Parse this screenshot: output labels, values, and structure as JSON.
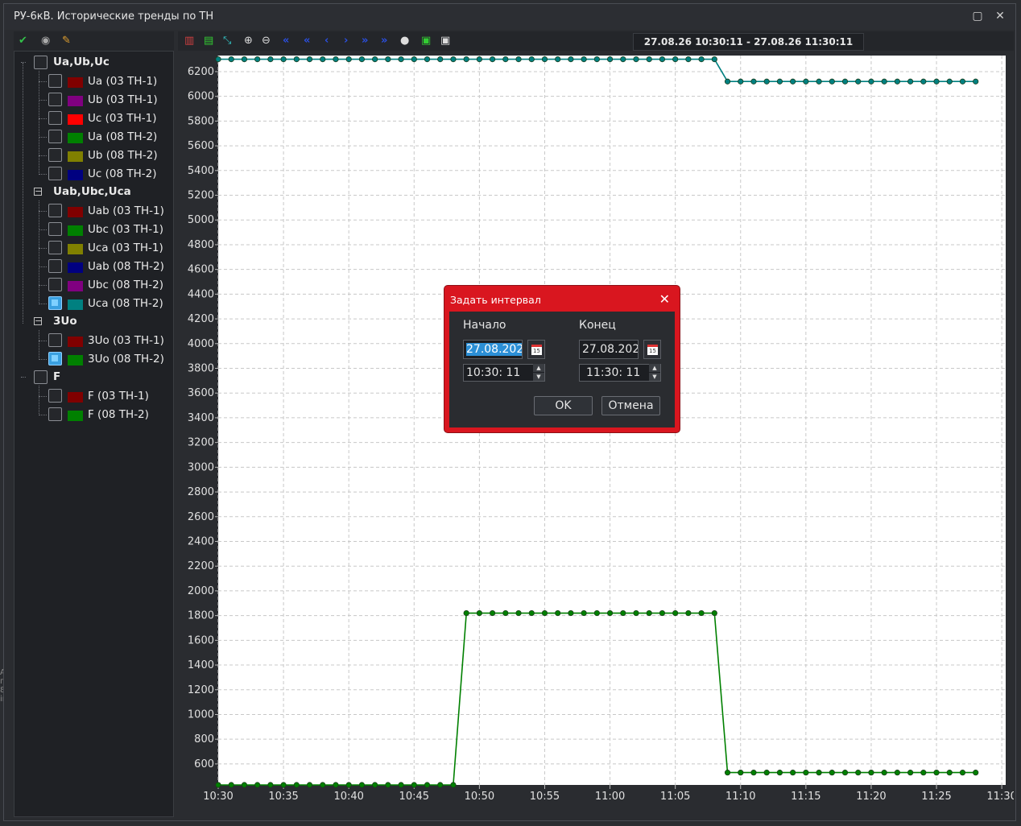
{
  "window": {
    "title": "РУ-6кВ. Исторические тренды по ТН"
  },
  "toolbar": {
    "range_label": "27.08.26 10:30:11 - 27.08.26 11:30:11"
  },
  "tree": {
    "groups": [
      {
        "label": "Ua,Ub,Uc",
        "items": [
          {
            "label": "Ua (03 ТН-1)",
            "color": "#800000",
            "checked": false
          },
          {
            "label": "Ub (03 ТН-1)",
            "color": "#800080",
            "checked": false
          },
          {
            "label": "Uc (03 ТН-1)",
            "color": "#ff0000",
            "checked": false
          },
          {
            "label": "Ua (08 ТН-2)",
            "color": "#008000",
            "checked": false
          },
          {
            "label": "Ub (08 ТН-2)",
            "color": "#808000",
            "checked": false
          },
          {
            "label": "Uc (08 ТН-2)",
            "color": "#000080",
            "checked": false
          }
        ]
      },
      {
        "label": "Uab,Ubc,Uca",
        "items": [
          {
            "label": "Uab (03 ТН-1)",
            "color": "#800000",
            "checked": false
          },
          {
            "label": "Ubc (03 ТН-1)",
            "color": "#008000",
            "checked": false
          },
          {
            "label": "Uca (03 ТН-1)",
            "color": "#808000",
            "checked": false
          },
          {
            "label": "Uab (08 ТН-2)",
            "color": "#000080",
            "checked": false
          },
          {
            "label": "Ubc (08 ТН-2)",
            "color": "#800080",
            "checked": false
          },
          {
            "label": "Uca (08 ТН-2)",
            "color": "#008080",
            "checked": true
          }
        ]
      },
      {
        "label": "3Uo",
        "items": [
          {
            "label": "3Uo (03 ТН-1)",
            "color": "#800000",
            "checked": false
          },
          {
            "label": "3Uo (08 ТН-2)",
            "color": "#008000",
            "checked": true
          }
        ]
      },
      {
        "label": "F",
        "items": [
          {
            "label": "F (03 ТН-1)",
            "color": "#800000",
            "checked": false
          },
          {
            "label": "F (08 ТН-2)",
            "color": "#008000",
            "checked": false
          }
        ]
      }
    ]
  },
  "dialog": {
    "title": "Задать интервал",
    "start_label": "Начало",
    "end_label": "Конец",
    "start_date": "27.08.202",
    "start_time": "10:30: 11",
    "end_date": "27.08.202",
    "end_time": "11:30: 11",
    "ok_label": "OK",
    "cancel_label": "Отмена",
    "cal_day": "15"
  },
  "left_edge_text": [
    "А",
    "г.",
    "8",
    "in"
  ],
  "chart_data": {
    "type": "line",
    "x_ticks": [
      "10:30",
      "10:35",
      "10:40",
      "10:45",
      "10:50",
      "10:55",
      "11:00",
      "11:05",
      "11:10",
      "11:15",
      "11:20",
      "11:25",
      "11:30"
    ],
    "y_ticks": [
      600,
      800,
      1000,
      1200,
      1400,
      1600,
      1800,
      2000,
      2200,
      2400,
      2600,
      2800,
      3000,
      3200,
      3400,
      3600,
      3800,
      4000,
      4200,
      4400,
      4600,
      4800,
      5000,
      5200,
      5400,
      5600,
      5800,
      6000,
      6200
    ],
    "xlim_minutes": [
      0,
      60.3
    ],
    "ylim": [
      430,
      6330
    ],
    "grid": true,
    "series": [
      {
        "color": "#008080",
        "x_minutes": [
          0,
          1,
          2,
          3,
          4,
          5,
          6,
          7,
          8,
          9,
          10,
          11,
          12,
          13,
          14,
          15,
          16,
          17,
          18,
          19,
          20,
          21,
          22,
          23,
          24,
          25,
          26,
          27,
          28,
          29,
          30,
          31,
          32,
          33,
          34,
          35,
          36,
          37,
          38,
          39,
          40,
          41,
          42,
          43,
          44,
          45,
          46,
          47,
          48,
          49,
          50,
          51,
          52,
          53,
          54,
          55,
          56,
          57,
          58
        ],
        "values": [
          6300,
          6300,
          6300,
          6300,
          6300,
          6300,
          6300,
          6300,
          6300,
          6300,
          6300,
          6300,
          6300,
          6300,
          6300,
          6300,
          6300,
          6300,
          6300,
          6300,
          6300,
          6300,
          6300,
          6300,
          6300,
          6300,
          6300,
          6300,
          6300,
          6300,
          6300,
          6300,
          6300,
          6300,
          6300,
          6300,
          6300,
          6300,
          6300,
          6120,
          6120,
          6120,
          6120,
          6120,
          6120,
          6120,
          6120,
          6120,
          6120,
          6120,
          6120,
          6120,
          6120,
          6120,
          6120,
          6120,
          6120,
          6120,
          6120
        ]
      },
      {
        "color": "#008000",
        "x_minutes": [
          0,
          1,
          2,
          3,
          4,
          5,
          6,
          7,
          8,
          9,
          10,
          11,
          12,
          13,
          14,
          15,
          16,
          17,
          18,
          19,
          20,
          21,
          22,
          23,
          24,
          25,
          26,
          27,
          28,
          29,
          30,
          31,
          32,
          33,
          34,
          35,
          36,
          37,
          38,
          39,
          40,
          41,
          42,
          43,
          44,
          45,
          46,
          47,
          48,
          49,
          50,
          51,
          52,
          53,
          54,
          55,
          56,
          57,
          58
        ],
        "values": [
          430,
          430,
          430,
          430,
          430,
          430,
          430,
          430,
          430,
          430,
          430,
          430,
          430,
          430,
          430,
          430,
          430,
          430,
          430,
          1820,
          1820,
          1820,
          1820,
          1820,
          1820,
          1820,
          1820,
          1820,
          1820,
          1820,
          1820,
          1820,
          1820,
          1820,
          1820,
          1820,
          1820,
          1820,
          1820,
          530,
          530,
          530,
          530,
          530,
          530,
          530,
          530,
          530,
          530,
          530,
          530,
          530,
          530,
          530,
          530,
          530,
          530,
          530,
          530
        ]
      }
    ]
  }
}
